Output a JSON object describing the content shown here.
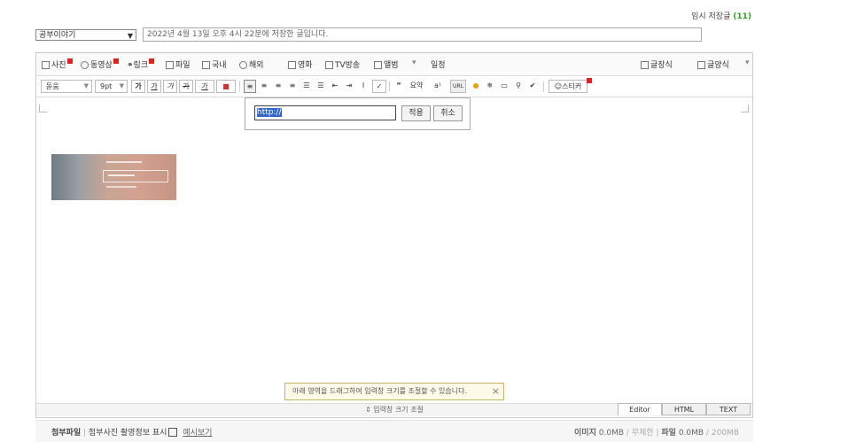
{
  "header": {
    "temp_save_label": "임시 저장글",
    "temp_save_count": "(11)"
  },
  "post": {
    "category": "공부이야기",
    "title_value": "2022년 4월 13일 오후 4시 22분에 저장한 글입니다."
  },
  "toolbar1": {
    "photo": "사진",
    "video": "동영상",
    "link": "링크",
    "file": "파일",
    "domestic": "국내",
    "overseas": "해외",
    "movie": "영화",
    "tv": "TV방송",
    "album": "앨범",
    "schedule": "일정",
    "quote_style": "글장식",
    "template": "글양식"
  },
  "toolbar2": {
    "font": "돋움",
    "size": "9pt",
    "bold": "가",
    "underline": "가",
    "italic": "가",
    "strike": "가",
    "text_color": "가",
    "quote_glyph": "“",
    "summary": "요약",
    "sup_glyph": "a¹",
    "url": "URL",
    "sticker": "스티커"
  },
  "link_popup": {
    "url_value": "http://",
    "apply": "적용",
    "cancel": "취소"
  },
  "tooltip": {
    "text": "아래 영역을 드래그하여 입력창 크기를 조절할 수 있습니다."
  },
  "resize_label": "⇕ 입력창 크기 조절",
  "modes": {
    "editor": "Editor",
    "html": "HTML",
    "text": "TEXT"
  },
  "footer": {
    "attach_label": "첨부파일",
    "exif_label": "첨부사진 촬영정보 표시",
    "preview": "예시보기",
    "image_label": "이미지",
    "image_size": "0.0MB",
    "image_limit": "/ 무제한",
    "file_label": "파일",
    "file_size": "0.0MB",
    "file_limit": "/ 200MB"
  },
  "colors": {
    "accent_green": "#3a9a2f",
    "badge_red": "#dd2222",
    "selection": "#3366cc"
  }
}
